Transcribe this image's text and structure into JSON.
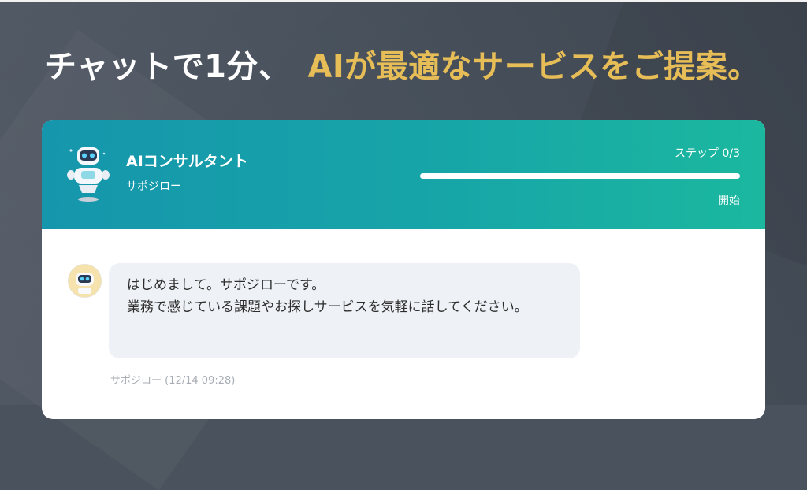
{
  "headline": {
    "main": "チャットで1分、",
    "accent": "AIが最適なサービスをご提案。",
    "accent_color": "#e6bd57"
  },
  "chat_header": {
    "agent_name": "AIコンサルタント",
    "agent_subtitle": "サポジロー",
    "step_label": "ステップ 0/3",
    "progress_fraction": 0.0,
    "progress_caption": "開始",
    "robot_icon": "robot-icon",
    "gradient_start": "#1696ac",
    "gradient_end": "#1bb89f"
  },
  "messages": [
    {
      "text": "はじめまして。サポジローです。\n業務で感じている課題やお探しサービスを気軽に話してください。",
      "meta": "サポジロー (12/14 09:28)",
      "avatar_icon": "robot-avatar-icon"
    }
  ]
}
